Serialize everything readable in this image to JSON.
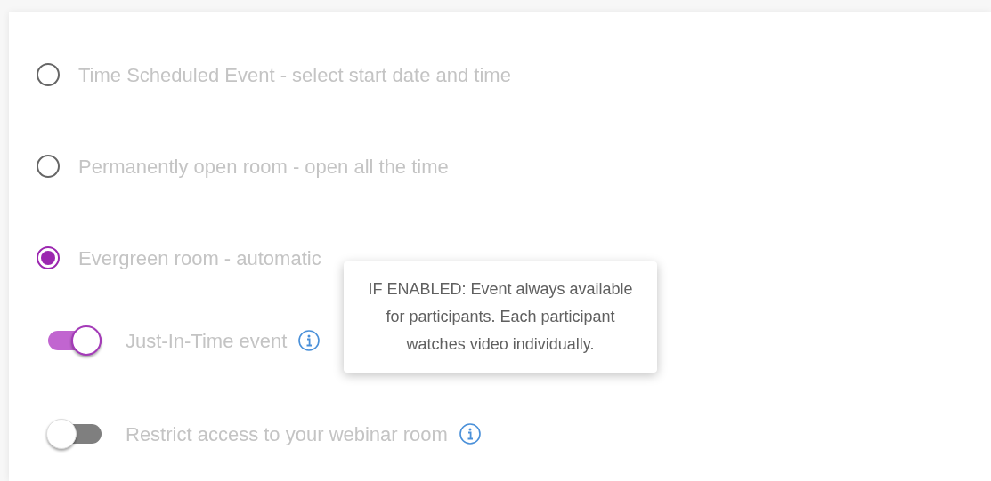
{
  "options": [
    {
      "label": "Time Scheduled Event - select start date and time",
      "selected": false
    },
    {
      "label": "Permanently open room - open all the time",
      "selected": false
    },
    {
      "label": "Evergreen room - automatic",
      "selected": true
    }
  ],
  "toggles": [
    {
      "label": "Just-In-Time event",
      "on": true
    },
    {
      "label": "Restrict access to your webinar room",
      "on": false
    }
  ],
  "tooltip": {
    "text": "IF ENABLED: Event always available for participants. Each participant watches video individually."
  }
}
